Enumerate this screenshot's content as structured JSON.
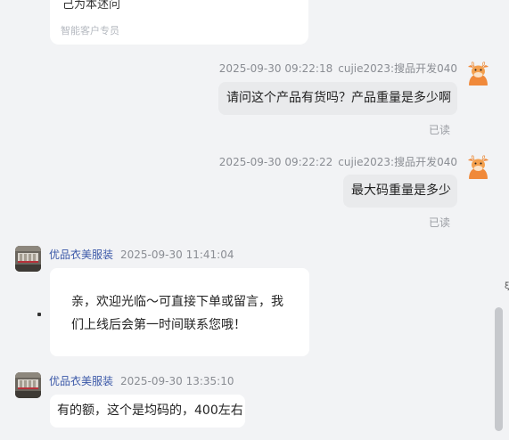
{
  "top_card": {
    "cut_text": "己为本述问",
    "agent_tag": "智能客户专员"
  },
  "messages": [
    {
      "timestamp": "2025-09-30 09:22:18",
      "sender": "cujie2023:搜品开发040",
      "text": "请问这个产品有货吗？产品重量是多少啊",
      "status": "已读"
    },
    {
      "timestamp": "2025-09-30 09:22:22",
      "sender": "cujie2023:搜品开发040",
      "text": "最大码重量是多少",
      "status": "已读"
    },
    {
      "shop": "优品衣美服装",
      "timestamp": "2025-09-30 11:41:04",
      "line1": "亲，欢迎光临～可直接下单或留言，我",
      "line2": "们上线后会第一时间联系您哦！"
    },
    {
      "shop": "优品衣美服装",
      "timestamp": "2025-09-30 13:35:10",
      "text": "有的额，这个是均码的，400左右"
    }
  ],
  "edge_glyph": "ξ",
  "colors": {
    "background": "#f2f3f5",
    "outgoing_bubble": "#e9eaec",
    "incoming_bubble": "#ffffff",
    "shop_name": "#3b58a8",
    "avatar_orange": "#f0893a"
  },
  "icons": [
    "cow-avatar-icon",
    "shop-avatar-icon"
  ]
}
